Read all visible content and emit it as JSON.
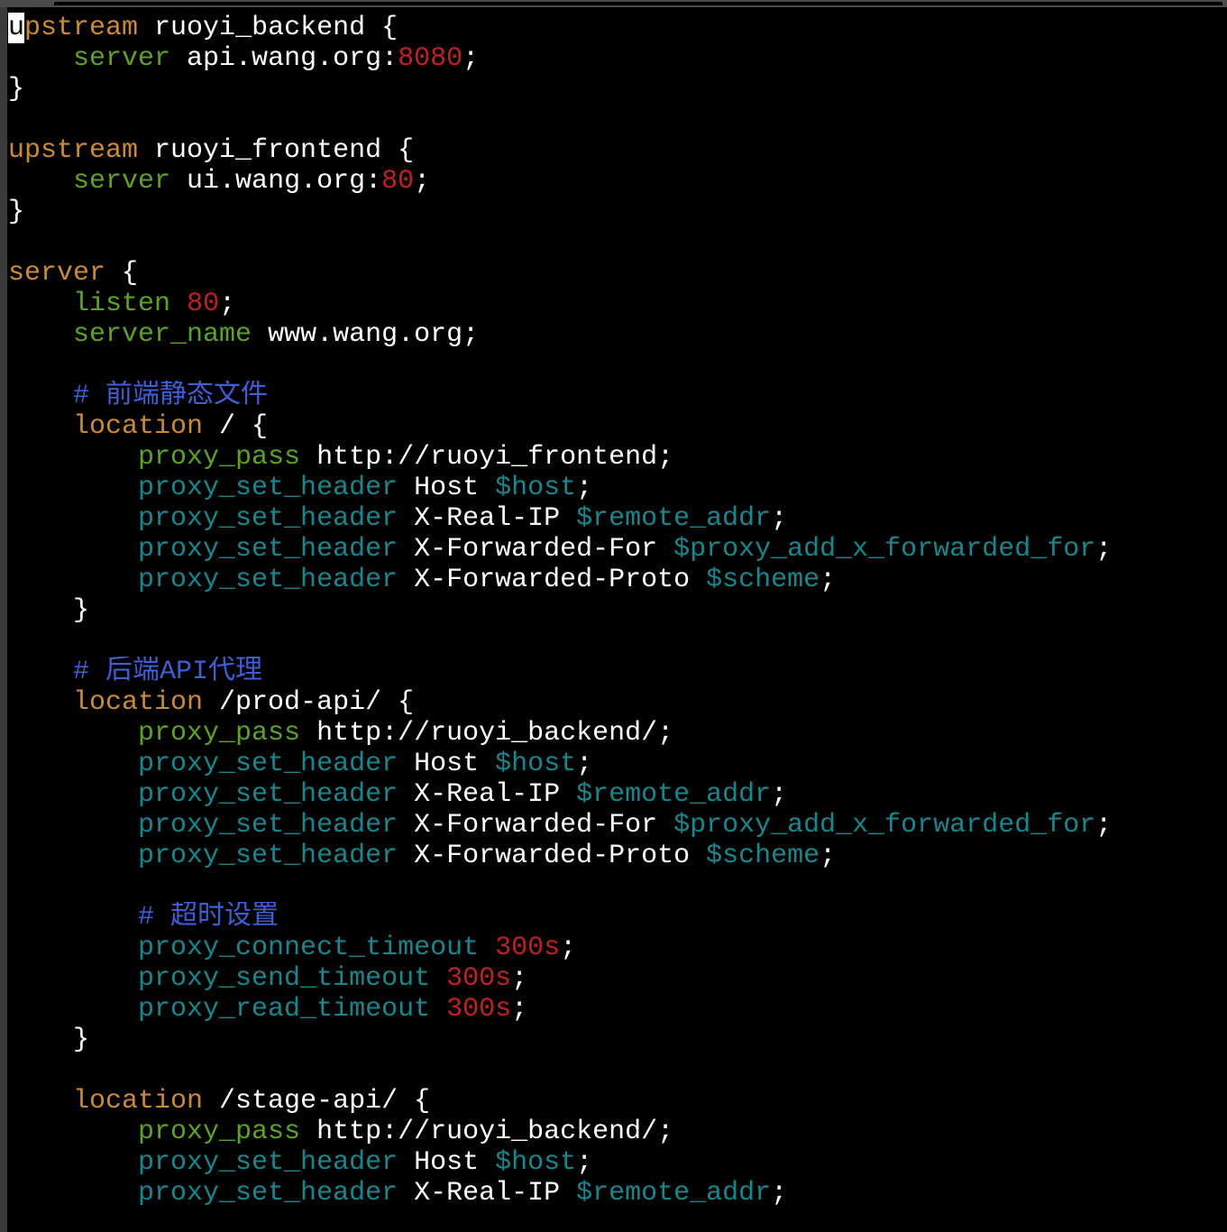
{
  "colors": {
    "background": "#000000",
    "keyword": "#cd8a2f",
    "directive": "#5aa421",
    "header_directive": "#14888f",
    "variable": "#14888f",
    "number": "#c41f1f",
    "comment": "#3c5fd7",
    "text": "#ffffff"
  },
  "code_lines": [
    {
      "tokens": [
        {
          "t": "u",
          "c": "cursor"
        },
        {
          "t": "pstream",
          "c": "kw"
        },
        {
          "t": " ruoyi_backend {",
          "c": "plain"
        }
      ]
    },
    {
      "tokens": [
        {
          "t": "    ",
          "c": "plain"
        },
        {
          "t": "server",
          "c": "dir"
        },
        {
          "t": " api.wang.org:",
          "c": "plain"
        },
        {
          "t": "8080",
          "c": "num"
        },
        {
          "t": ";",
          "c": "plain"
        }
      ]
    },
    {
      "tokens": [
        {
          "t": "}",
          "c": "plain"
        }
      ]
    },
    {
      "tokens": []
    },
    {
      "tokens": [
        {
          "t": "upstream",
          "c": "kw"
        },
        {
          "t": " ruoyi_frontend {",
          "c": "plain"
        }
      ]
    },
    {
      "tokens": [
        {
          "t": "    ",
          "c": "plain"
        },
        {
          "t": "server",
          "c": "dir"
        },
        {
          "t": " ui.wang.org:",
          "c": "plain"
        },
        {
          "t": "80",
          "c": "num"
        },
        {
          "t": ";",
          "c": "plain"
        }
      ]
    },
    {
      "tokens": [
        {
          "t": "}",
          "c": "plain"
        }
      ]
    },
    {
      "tokens": []
    },
    {
      "tokens": [
        {
          "t": "server",
          "c": "kw"
        },
        {
          "t": " {",
          "c": "plain"
        }
      ]
    },
    {
      "tokens": [
        {
          "t": "    ",
          "c": "plain"
        },
        {
          "t": "listen",
          "c": "dir"
        },
        {
          "t": " ",
          "c": "plain"
        },
        {
          "t": "80",
          "c": "num"
        },
        {
          "t": ";",
          "c": "plain"
        }
      ]
    },
    {
      "tokens": [
        {
          "t": "    ",
          "c": "plain"
        },
        {
          "t": "server_name",
          "c": "dir"
        },
        {
          "t": " www.wang.org;",
          "c": "plain"
        }
      ]
    },
    {
      "tokens": []
    },
    {
      "tokens": [
        {
          "t": "    ",
          "c": "plain"
        },
        {
          "t": "# 前端静态文件",
          "c": "cmt"
        }
      ]
    },
    {
      "tokens": [
        {
          "t": "    ",
          "c": "plain"
        },
        {
          "t": "location",
          "c": "kw"
        },
        {
          "t": " / {",
          "c": "plain"
        }
      ]
    },
    {
      "tokens": [
        {
          "t": "        ",
          "c": "plain"
        },
        {
          "t": "proxy_pass",
          "c": "dir"
        },
        {
          "t": " http://ruoyi_frontend;",
          "c": "plain"
        }
      ]
    },
    {
      "tokens": [
        {
          "t": "        ",
          "c": "plain"
        },
        {
          "t": "proxy_set_header",
          "c": "hdr"
        },
        {
          "t": " Host ",
          "c": "plain"
        },
        {
          "t": "$host",
          "c": "var"
        },
        {
          "t": ";",
          "c": "plain"
        }
      ]
    },
    {
      "tokens": [
        {
          "t": "        ",
          "c": "plain"
        },
        {
          "t": "proxy_set_header",
          "c": "hdr"
        },
        {
          "t": " X-Real-IP ",
          "c": "plain"
        },
        {
          "t": "$remote_addr",
          "c": "var"
        },
        {
          "t": ";",
          "c": "plain"
        }
      ]
    },
    {
      "tokens": [
        {
          "t": "        ",
          "c": "plain"
        },
        {
          "t": "proxy_set_header",
          "c": "hdr"
        },
        {
          "t": " X-Forwarded-For ",
          "c": "plain"
        },
        {
          "t": "$proxy_add_x_forwarded_for",
          "c": "var"
        },
        {
          "t": ";",
          "c": "plain"
        }
      ]
    },
    {
      "tokens": [
        {
          "t": "        ",
          "c": "plain"
        },
        {
          "t": "proxy_set_header",
          "c": "hdr"
        },
        {
          "t": " X-Forwarded-Proto ",
          "c": "plain"
        },
        {
          "t": "$scheme",
          "c": "var"
        },
        {
          "t": ";",
          "c": "plain"
        }
      ]
    },
    {
      "tokens": [
        {
          "t": "    }",
          "c": "plain"
        }
      ]
    },
    {
      "tokens": []
    },
    {
      "tokens": [
        {
          "t": "    ",
          "c": "plain"
        },
        {
          "t": "# 后端API代理",
          "c": "cmt"
        }
      ]
    },
    {
      "tokens": [
        {
          "t": "    ",
          "c": "plain"
        },
        {
          "t": "location",
          "c": "kw"
        },
        {
          "t": " /prod-api/ {",
          "c": "plain"
        }
      ]
    },
    {
      "tokens": [
        {
          "t": "        ",
          "c": "plain"
        },
        {
          "t": "proxy_pass",
          "c": "dir"
        },
        {
          "t": " http://ruoyi_backend/;",
          "c": "plain"
        }
      ]
    },
    {
      "tokens": [
        {
          "t": "        ",
          "c": "plain"
        },
        {
          "t": "proxy_set_header",
          "c": "hdr"
        },
        {
          "t": " Host ",
          "c": "plain"
        },
        {
          "t": "$host",
          "c": "var"
        },
        {
          "t": ";",
          "c": "plain"
        }
      ]
    },
    {
      "tokens": [
        {
          "t": "        ",
          "c": "plain"
        },
        {
          "t": "proxy_set_header",
          "c": "hdr"
        },
        {
          "t": " X-Real-IP ",
          "c": "plain"
        },
        {
          "t": "$remote_addr",
          "c": "var"
        },
        {
          "t": ";",
          "c": "plain"
        }
      ]
    },
    {
      "tokens": [
        {
          "t": "        ",
          "c": "plain"
        },
        {
          "t": "proxy_set_header",
          "c": "hdr"
        },
        {
          "t": " X-Forwarded-For ",
          "c": "plain"
        },
        {
          "t": "$proxy_add_x_forwarded_for",
          "c": "var"
        },
        {
          "t": ";",
          "c": "plain"
        }
      ]
    },
    {
      "tokens": [
        {
          "t": "        ",
          "c": "plain"
        },
        {
          "t": "proxy_set_header",
          "c": "hdr"
        },
        {
          "t": " X-Forwarded-Proto ",
          "c": "plain"
        },
        {
          "t": "$scheme",
          "c": "var"
        },
        {
          "t": ";",
          "c": "plain"
        }
      ]
    },
    {
      "tokens": []
    },
    {
      "tokens": [
        {
          "t": "        ",
          "c": "plain"
        },
        {
          "t": "# 超时设置",
          "c": "cmt"
        }
      ]
    },
    {
      "tokens": [
        {
          "t": "        ",
          "c": "plain"
        },
        {
          "t": "proxy_connect_timeout",
          "c": "hdr"
        },
        {
          "t": " ",
          "c": "plain"
        },
        {
          "t": "300s",
          "c": "num"
        },
        {
          "t": ";",
          "c": "plain"
        }
      ]
    },
    {
      "tokens": [
        {
          "t": "        ",
          "c": "plain"
        },
        {
          "t": "proxy_send_timeout",
          "c": "hdr"
        },
        {
          "t": " ",
          "c": "plain"
        },
        {
          "t": "300s",
          "c": "num"
        },
        {
          "t": ";",
          "c": "plain"
        }
      ]
    },
    {
      "tokens": [
        {
          "t": "        ",
          "c": "plain"
        },
        {
          "t": "proxy_read_timeout",
          "c": "hdr"
        },
        {
          "t": " ",
          "c": "plain"
        },
        {
          "t": "300s",
          "c": "num"
        },
        {
          "t": ";",
          "c": "plain"
        }
      ]
    },
    {
      "tokens": [
        {
          "t": "    }",
          "c": "plain"
        }
      ]
    },
    {
      "tokens": []
    },
    {
      "tokens": [
        {
          "t": "    ",
          "c": "plain"
        },
        {
          "t": "location",
          "c": "kw"
        },
        {
          "t": " /stage-api/ {",
          "c": "plain"
        }
      ]
    },
    {
      "tokens": [
        {
          "t": "        ",
          "c": "plain"
        },
        {
          "t": "proxy_pass",
          "c": "dir"
        },
        {
          "t": " http://ruoyi_backend/;",
          "c": "plain"
        }
      ]
    },
    {
      "tokens": [
        {
          "t": "        ",
          "c": "plain"
        },
        {
          "t": "proxy_set_header",
          "c": "hdr"
        },
        {
          "t": " Host ",
          "c": "plain"
        },
        {
          "t": "$host",
          "c": "var"
        },
        {
          "t": ";",
          "c": "plain"
        }
      ]
    },
    {
      "tokens": [
        {
          "t": "        ",
          "c": "plain"
        },
        {
          "t": "proxy_set_header",
          "c": "hdr"
        },
        {
          "t": " X-Real-IP ",
          "c": "plain"
        },
        {
          "t": "$remote_addr",
          "c": "var"
        },
        {
          "t": ";",
          "c": "plain"
        }
      ]
    }
  ]
}
